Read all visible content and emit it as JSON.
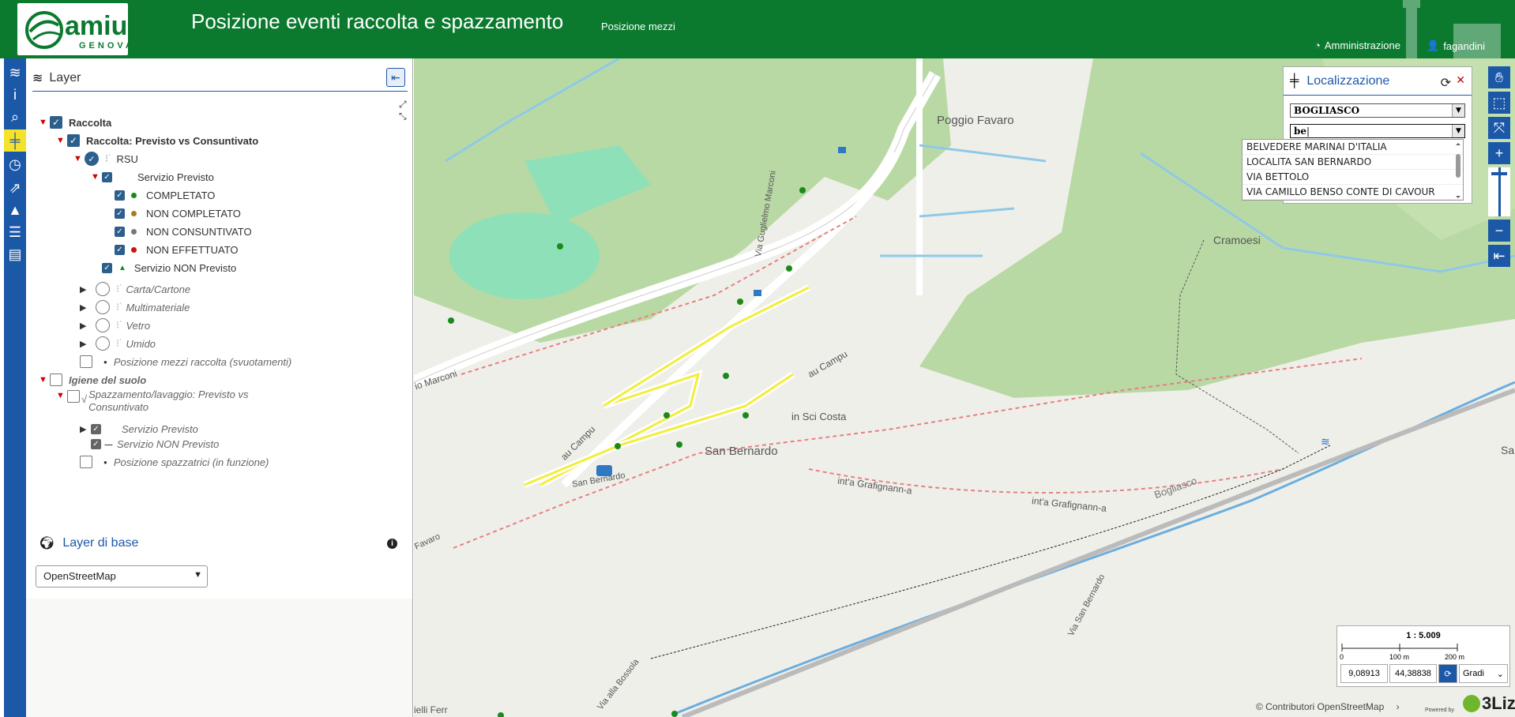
{
  "header": {
    "logo_text": "amiu",
    "logo_subtext": "GENOVA",
    "title": "Posizione eventi raccolta e spazzamento",
    "subtitle": "Posizione mezzi",
    "admin_link": "Amministrazione",
    "user_name": "fagandini"
  },
  "panel": {
    "title": "Layer",
    "tree": {
      "raccolta": "Raccolta",
      "raccolta_pvc": "Raccolta: Previsto vs Consuntivato",
      "rsu": "RSU",
      "servizio_previsto": "Servizio Previsto",
      "completato": "COMPLETATO",
      "non_completato": "NON COMPLETATO",
      "non_consuntivato": "NON CONSUNTIVATO",
      "non_effettuato": "NON EFFETTUATO",
      "servizio_non_previsto": "Servizio NON Previsto",
      "carta": "Carta/Cartone",
      "multimateriale": "Multimateriale",
      "vetro": "Vetro",
      "umido": "Umido",
      "posizione_mezzi": "Posizione mezzi raccolta (svuotamenti)",
      "igiene": "Igiene del suolo",
      "spazzamento_1": "Spazzamento/lavaggio: Previsto vs",
      "spazzamento_2": "Consuntivato",
      "spaz_previsto": "Servizio Previsto",
      "spaz_non_previsto": "Servizio NON Previsto",
      "posizione_spazzatrici": "Posizione spazzatrici (in funzione)"
    },
    "base_layer_title": "Layer di base",
    "base_layer_value": "OpenStreetMap"
  },
  "colors": {
    "header_green": "#0b7a2f",
    "toolbar_blue": "#1c58a8",
    "completato": "#1a8a1a",
    "non_completato": "#a7801d",
    "non_consuntivato": "#777777",
    "non_effettuato": "#cc1111"
  },
  "localizzazione": {
    "title": "Localizzazione",
    "comune": "BOGLIASCO",
    "search_value": "be",
    "options": [
      "BELVEDERE MARINAI D'ITALIA",
      "LOCALITA SAN BERNARDO",
      "VIA BETTOLO",
      "VIA CAMILLO BENSO CONTE DI CAVOUR"
    ]
  },
  "map_labels": {
    "poggio_favaro": "Poggio Favaro",
    "via_guglielmo_marconi": "Via Guglielmo Marconi",
    "cramoesi": "Cramoesi",
    "marconi": "io Marconi",
    "au_campu_1": "au Campu",
    "au_campu_2": "au Campu",
    "in_sci_costa": "in Sci Costa",
    "san_bernardo": "San Bernardo",
    "san_bernardo_road": "San Bernardo",
    "favaro": "Favaro",
    "grafignanna_1": "int'a Grafignann-a",
    "grafignanna_2": "int'a Grafignann-a",
    "bogliasco": "Bogliasco",
    "via_san_bernardo": "Via San Bernardo",
    "via_alla_bossola": "Via alla Bossola",
    "felli_ferr": "ielli Ferr",
    "sa": "Sa"
  },
  "scale": {
    "ratio": "1 : 5.009",
    "t0": "0",
    "t100": "100 m",
    "t200": "200 m",
    "lon": "9,08913",
    "lat": "44,38838",
    "units": "Gradi"
  },
  "attribution": "© Contributori OpenStreetMap",
  "powered_by": "Powered by",
  "powered_logo": "3Liz"
}
